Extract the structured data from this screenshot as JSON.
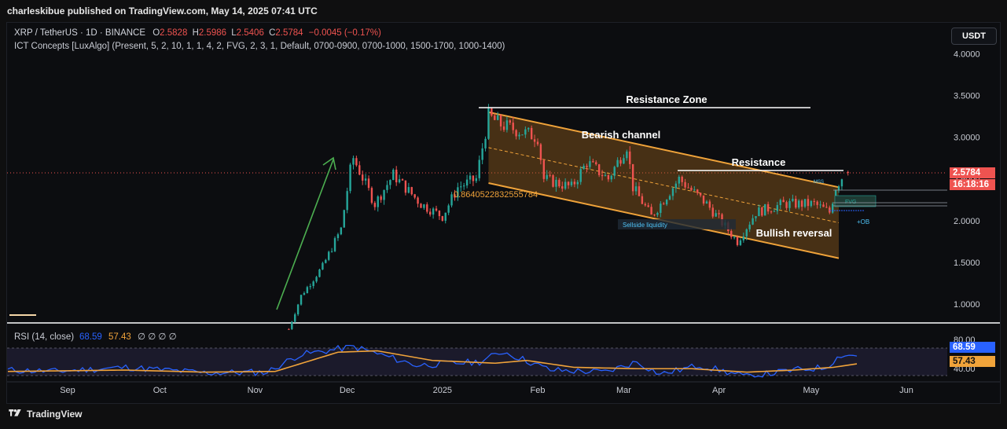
{
  "header": {
    "published": "charleskibue published on TradingView.com, May 14, 2025 07:41 UTC"
  },
  "legend": {
    "symbol": "XRP / TetherUS · 1D · BINANCE",
    "o_label": "O",
    "o": "2.5828",
    "h_label": "H",
    "h": "2.5986",
    "l_label": "L",
    "l": "2.5406",
    "c_label": "C",
    "c": "2.5784",
    "change": "−0.0045 (−0.17%)",
    "indicator": "ICT Concepts [LuxAlgo] (Present, 5, 2, 10, 1, 1, 4, 2, FVG, 2, 3, 1, Default, 0700-0900, 0700-1000, 1500-1700, 1000-1400)"
  },
  "currency_button": "USDT",
  "price_axis": {
    "ticks": [
      "4.0000",
      "3.5000",
      "3.0000",
      "2.5000",
      "2.0000",
      "1.5000",
      "1.0000"
    ],
    "current_price": "2.5784",
    "countdown": "16:18:16"
  },
  "time_axis": {
    "ticks": [
      "Sep",
      "Oct",
      "Nov",
      "Dec",
      "2025",
      "Feb",
      "Mar",
      "Apr",
      "May",
      "Jun"
    ]
  },
  "annotations": {
    "resistance_zone": "Resistance Zone",
    "bearish_channel": "Bearish channel",
    "resistance": "Resistance",
    "bullish_reversal": "Bullish reversal",
    "sellside_liquidity": "Sellside liquidity",
    "long_number": "0.8640522832555784",
    "mss": "MSS",
    "fvg": "FVG",
    "plus_ob": "+OB"
  },
  "rsi": {
    "label": "RSI (14, close)",
    "value": "68.59",
    "ma_value": "57.43",
    "extra": "∅ ∅ ∅ ∅",
    "axis_top": "80.00",
    "axis_bottom": "40.00"
  },
  "footer": {
    "brand": "TradingView"
  },
  "colors": {
    "up": "#26a69a",
    "down": "#ef5350",
    "channel": "#f0a33a",
    "rsi_line": "#2962ff",
    "rsi_ma": "#f0a33a",
    "price_tag": "#ef5350"
  },
  "chart_data": [
    {
      "type": "candlestick",
      "title": "XRP / TetherUS · 1D · BINANCE",
      "ylim": [
        0.7,
        4.25
      ],
      "x_ticks": [
        "Sep",
        "Oct",
        "Nov",
        "Dec",
        "2025",
        "Feb",
        "Mar",
        "Apr",
        "May",
        "Jun"
      ],
      "approx_close_path": [
        {
          "date": "2024-11-12",
          "value": 0.7
        },
        {
          "date": "2024-11-16",
          "value": 1.1
        },
        {
          "date": "2024-11-23",
          "value": 1.45
        },
        {
          "date": "2024-11-29",
          "value": 1.9
        },
        {
          "date": "2024-12-02",
          "value": 2.6
        },
        {
          "date": "2024-12-03",
          "value": 2.75
        },
        {
          "date": "2024-12-10",
          "value": 2.2
        },
        {
          "date": "2024-12-16",
          "value": 2.55
        },
        {
          "date": "2024-12-25",
          "value": 2.2
        },
        {
          "date": "2025-01-01",
          "value": 2.05
        },
        {
          "date": "2025-01-06",
          "value": 2.4
        },
        {
          "date": "2025-01-12",
          "value": 2.5
        },
        {
          "date": "2025-01-16",
          "value": 3.25
        },
        {
          "date": "2025-01-20",
          "value": 3.15
        },
        {
          "date": "2025-02-01",
          "value": 3.0
        },
        {
          "date": "2025-02-03",
          "value": 2.5
        },
        {
          "date": "2025-02-12",
          "value": 2.4
        },
        {
          "date": "2025-02-17",
          "value": 2.7
        },
        {
          "date": "2025-02-24",
          "value": 2.5
        },
        {
          "date": "2025-03-02",
          "value": 2.9
        },
        {
          "date": "2025-03-04",
          "value": 2.4
        },
        {
          "date": "2025-03-10",
          "value": 2.05
        },
        {
          "date": "2025-03-19",
          "value": 2.5
        },
        {
          "date": "2025-03-28",
          "value": 2.2
        },
        {
          "date": "2025-04-07",
          "value": 1.75
        },
        {
          "date": "2025-04-13",
          "value": 2.1
        },
        {
          "date": "2025-04-22",
          "value": 2.2
        },
        {
          "date": "2025-05-02",
          "value": 2.2
        },
        {
          "date": "2025-05-07",
          "value": 2.1
        },
        {
          "date": "2025-05-09",
          "value": 2.4
        },
        {
          "date": "2025-05-12",
          "value": 2.58
        }
      ],
      "last": {
        "open": 2.5828,
        "high": 2.5986,
        "low": 2.5406,
        "close": 2.5784
      },
      "levels": [
        {
          "label": "Resistance Zone",
          "value": 3.35
        },
        {
          "label": "Resistance",
          "value": 2.6
        }
      ],
      "channel": {
        "label": "Bearish channel",
        "upper": [
          {
            "date": "2025-01-16",
            "value": 3.3
          },
          {
            "date": "2025-05-10",
            "value": 2.4
          }
        ],
        "lower": [
          {
            "date": "2025-01-16",
            "value": 2.45
          },
          {
            "date": "2025-05-10",
            "value": 1.55
          }
        ]
      }
    },
    {
      "type": "line",
      "title": "RSI (14, close)",
      "ylim": [
        40,
        80
      ],
      "series": [
        {
          "name": "RSI",
          "last": 68.59
        },
        {
          "name": "RSI-based MA",
          "last": 57.43
        }
      ]
    }
  ]
}
